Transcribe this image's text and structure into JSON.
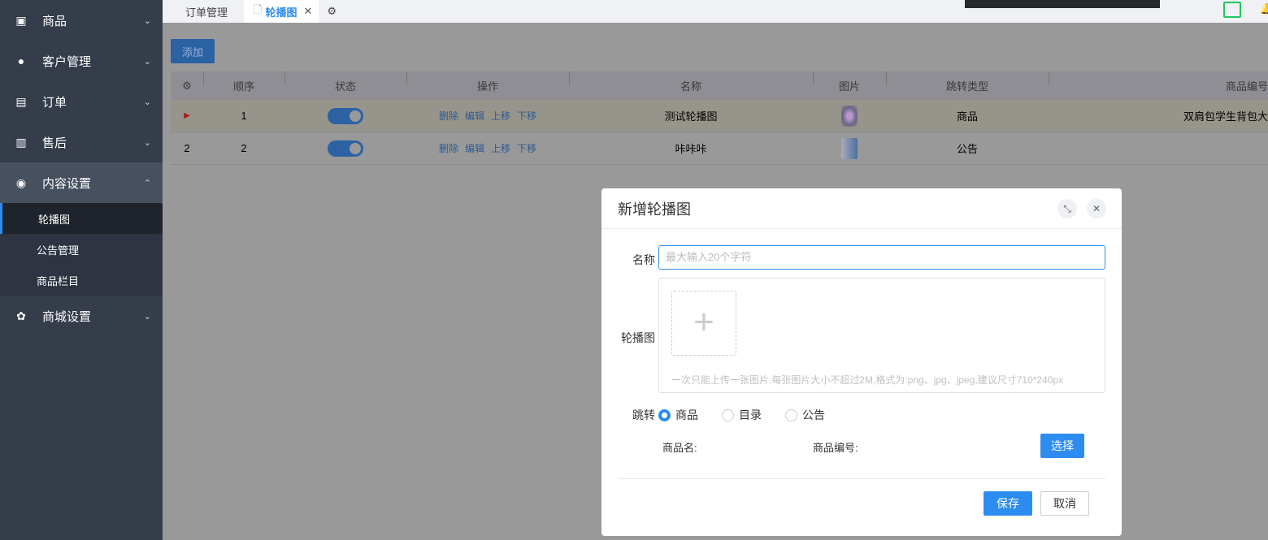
{
  "sidebar": {
    "menus": [
      {
        "label": "商品"
      },
      {
        "label": "客户管理"
      },
      {
        "label": "订单"
      },
      {
        "label": "售后"
      },
      {
        "label": "内容设置"
      },
      {
        "label": "商城设置"
      }
    ],
    "sub": [
      {
        "label": "轮播图"
      },
      {
        "label": "公告管理"
      },
      {
        "label": "商品栏目"
      }
    ]
  },
  "tabs": [
    {
      "label": "订单管理"
    },
    {
      "label": "轮播图"
    }
  ],
  "main": {
    "add_label": "添加",
    "headers": [
      "顺序",
      "状态",
      "操作",
      "名称",
      "图片",
      "跳转类型",
      "商品编号"
    ],
    "ops": [
      "删除",
      "编辑",
      "上移",
      "下移"
    ],
    "rows": [
      {
        "index": "",
        "order": "1",
        "enabled": true,
        "name": "测试轮播图",
        "type": "商品",
        "code": "双肩包学生背包大"
      },
      {
        "index": "2",
        "order": "2",
        "enabled": true,
        "name": "咔咔咔",
        "type": "公告",
        "code": ""
      }
    ]
  },
  "dialog": {
    "title": "新增轮播图",
    "name_label": "名称",
    "name_placeholder": "最大输入20个字符",
    "image_label": "轮播图",
    "hint": "一次只能上传一张图片,每张图片大小不超过2M,格式为:png、jpg、jpeg,建议尺寸710*240px",
    "jump_label": "跳转",
    "options": [
      "商品",
      "目录",
      "公告"
    ],
    "selected": "商品",
    "product_name_label": "商品名:",
    "product_code_label": "商品编号:",
    "select_label": "选择",
    "save_label": "保存",
    "cancel_label": "取消"
  },
  "colors": {
    "accent": "#2d8cf0",
    "sidebar": "#353c4a"
  }
}
